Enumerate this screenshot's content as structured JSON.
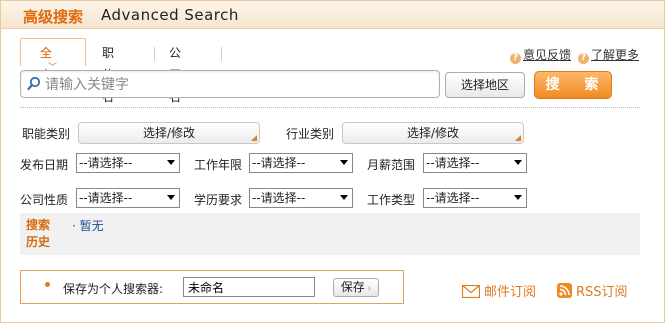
{
  "header": {
    "title_cn": "高级搜索",
    "title_en": "Advanced Search"
  },
  "tabs": [
    {
      "label": "全文",
      "active": true
    },
    {
      "label": "职位名",
      "active": false
    },
    {
      "label": "公司名",
      "active": false
    }
  ],
  "toplinks": {
    "feedback": "意见反馈",
    "more": "了解更多"
  },
  "search": {
    "placeholder": "请输入关键字",
    "value": "",
    "region_button": "选择地区",
    "submit_label": "搜 索"
  },
  "categories": {
    "function_label": "职能类别",
    "function_button": "选择/修改",
    "industry_label": "行业类别",
    "industry_button": "选择/修改"
  },
  "filters_row1": [
    {
      "label": "发布日期",
      "value": "--请选择--"
    },
    {
      "label": "工作年限",
      "value": "--请选择--"
    },
    {
      "label": "月薪范围",
      "value": "--请选择--"
    }
  ],
  "filters_row2": [
    {
      "label": "公司性质",
      "value": "--请选择--"
    },
    {
      "label": "学历要求",
      "value": "--请选择--"
    },
    {
      "label": "工作类型",
      "value": "--请选择--"
    }
  ],
  "history": {
    "label": "搜索历史",
    "empty_text": "· 暂无"
  },
  "save": {
    "label": "保存为个人搜索器:",
    "value": "未命名",
    "button": "保存"
  },
  "subscribe": {
    "email": "邮件订阅",
    "rss": "RSS订阅"
  },
  "colors": {
    "accent": "#e07a20",
    "title": "#e06a10",
    "search_button": "#f08a22",
    "link_blue": "#1a4f96"
  },
  "icons": {
    "search": "magnifier-icon",
    "question": "question-circle-icon",
    "email": "envelope-icon",
    "rss": "rss-icon",
    "corner": "corner-triangle-icon",
    "dropdown": "chevron-down-icon"
  }
}
